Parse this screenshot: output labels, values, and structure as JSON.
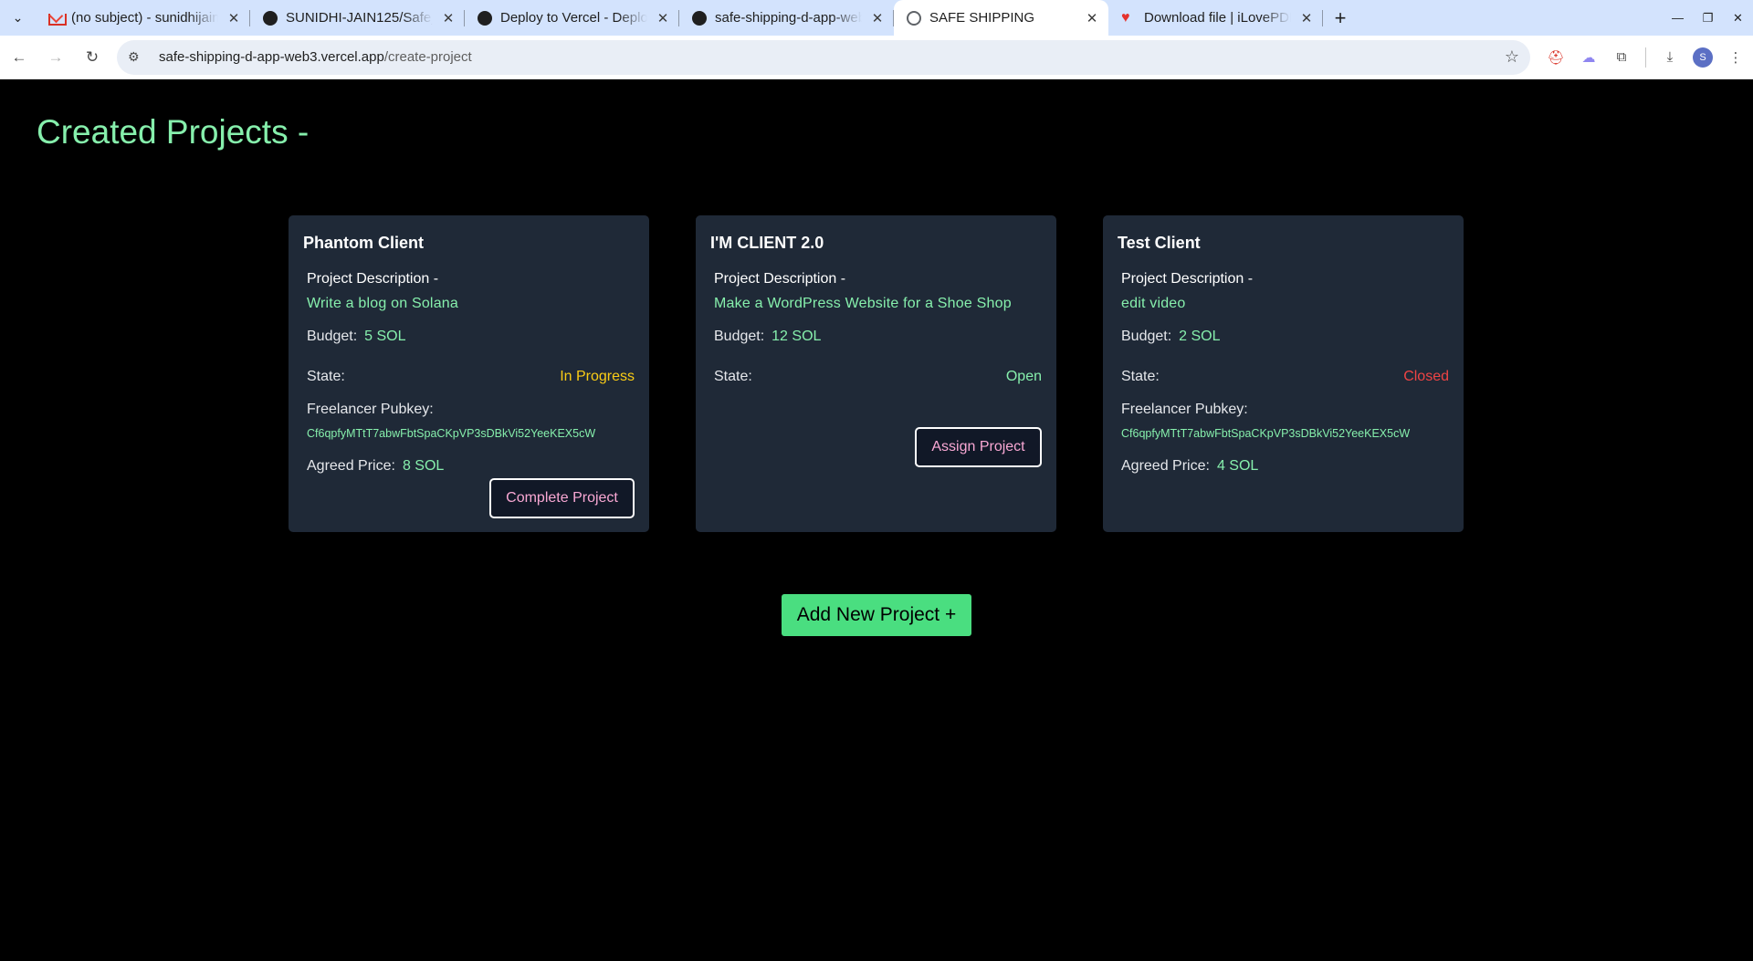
{
  "browser": {
    "tabs": [
      {
        "title": "(no subject) - sunidhijain",
        "icon": "gmail-icon"
      },
      {
        "title": "SUNIDHI-JAIN125/Safe_",
        "icon": "github-icon"
      },
      {
        "title": "Deploy to Vercel - Deplo",
        "icon": "nextjs-icon"
      },
      {
        "title": "safe-shipping-d-app-web",
        "icon": "vercel-icon"
      },
      {
        "title": "SAFE SHIPPING",
        "icon": "globe-icon",
        "active": true
      },
      {
        "title": "Download file | iLovePDF",
        "icon": "ilovepdf-icon"
      }
    ],
    "url_host": "safe-shipping-d-app-web3.vercel.app",
    "url_path": "/create-project",
    "profile_initial": "S"
  },
  "page": {
    "title": "Created Projects -",
    "labels": {
      "description": "Project Description -",
      "budget": "Budget:",
      "state": "State:",
      "freelancer": "Freelancer Pubkey:",
      "agreed": "Agreed Price:"
    },
    "projects": [
      {
        "client": "Phantom Client",
        "description": "Write a blog on Solana",
        "budget": "5 SOL",
        "state": "In Progress",
        "freelancer_pubkey": "Cf6qpfyMTtT7abwFbtSpaCKpVP3sDBkVi52YeeKEX5cW",
        "agreed_price": "8 SOL",
        "action": "Complete Project"
      },
      {
        "client": "I'M CLIENT 2.0",
        "description": "Make a WordPress Website for a Shoe Shop",
        "budget": "12 SOL",
        "state": "Open",
        "action": "Assign Project"
      },
      {
        "client": "Test Client",
        "description": "edit video",
        "budget": "2 SOL",
        "state": "Closed",
        "freelancer_pubkey": "Cf6qpfyMTtT7abwFbtSpaCKpVP3sDBkVi52YeeKEX5cW",
        "agreed_price": "4 SOL"
      }
    ],
    "add_button": "Add New Project +"
  },
  "colors": {
    "page_bg": "#000000",
    "card_bg": "#1f2937",
    "accent_green": "#86efac",
    "button_green": "#4ade80",
    "state_in_progress": "#facc15",
    "state_open": "#86efac",
    "state_closed": "#ef4444",
    "action_text": "#f9a8d4"
  }
}
